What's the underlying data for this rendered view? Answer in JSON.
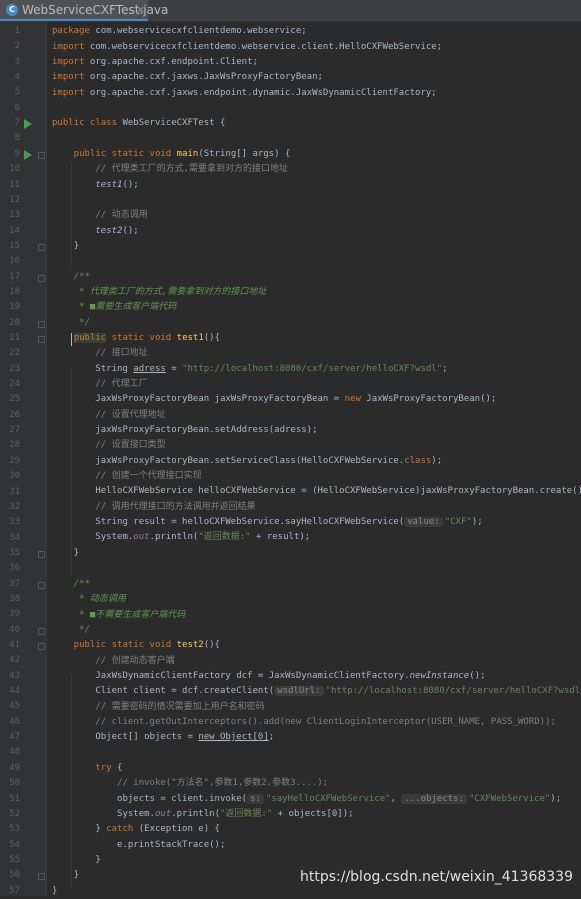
{
  "tab": {
    "filename": "WebServiceCXFTest.java",
    "close": "×"
  },
  "line_numbers": [
    "1",
    "2",
    "3",
    "4",
    "5",
    "6",
    "7",
    "8",
    "9",
    "10",
    "11",
    "12",
    "13",
    "14",
    "15",
    "16",
    "17",
    "18",
    "19",
    "20",
    "21",
    "22",
    "23",
    "24",
    "25",
    "26",
    "27",
    "28",
    "29",
    "30",
    "31",
    "32",
    "33",
    "34",
    "35",
    "36",
    "37",
    "38",
    "39",
    "40",
    "41",
    "42",
    "43",
    "44",
    "45",
    "46",
    "47",
    "48",
    "49",
    "50",
    "51",
    "52",
    "53",
    "54",
    "55",
    "56",
    "57"
  ],
  "code": {
    "l1": {
      "a": "package",
      "b": " com.webservicecxfclientdemo.webservice;"
    },
    "l2": {
      "a": "import",
      "b": " com.webservicecxfclientdemo.webservice.client.HelloCXFWebService;"
    },
    "l3": {
      "a": "import",
      "b": " org.apache.cxf.endpoint.Client;"
    },
    "l4": {
      "a": "import",
      "b": " org.apache.cxf.jaxws.JaxWsProxyFactoryBean;"
    },
    "l5": {
      "a": "import",
      "b": " org.apache.cxf.jaxws.endpoint.dynamic.JaxWsDynamicClientFactory;"
    },
    "l7": {
      "a": "public class",
      "b": " WebServiceCXFTest {"
    },
    "l9": {
      "a": "    public static void ",
      "b": "main",
      "c": "(String[] args) {"
    },
    "l10": {
      "a": "        // 代理类工厂的方式,需要拿到对方的接口地址"
    },
    "l11": {
      "a": "        ",
      "b": "test1",
      "c": "();"
    },
    "l13": {
      "a": "        // 动态调用"
    },
    "l14": {
      "a": "        ",
      "b": "test2",
      "c": "();"
    },
    "l15": {
      "a": "    }"
    },
    "l17": {
      "a": "    /**"
    },
    "l18": {
      "a": "     * 代理类工厂的方式,需要拿到对方的接口地址"
    },
    "l19": {
      "a": "     * ■需要生成客户端代码"
    },
    "l20": {
      "a": "     */"
    },
    "l21": {
      "a": "    ",
      "b": "public",
      "c": " static void ",
      "d": "test1",
      "e": "(){"
    },
    "l22": {
      "a": "        // 接口地址"
    },
    "l23": {
      "a": "        String ",
      "b": "adress",
      "c": " = ",
      "d": "\"http://localhost:8080/cxf/server/helloCXF?wsdl\"",
      "e": ";"
    },
    "l24": {
      "a": "        // 代理工厂"
    },
    "l25": {
      "a": "        JaxWsProxyFactoryBean jaxWsProxyFactoryBean = ",
      "b": "new",
      "c": " JaxWsProxyFactoryBean();"
    },
    "l26": {
      "a": "        // 设置代理地址"
    },
    "l27": {
      "a": "        jaxWsProxyFactoryBean.setAddress(adress);"
    },
    "l28": {
      "a": "        // 设置接口类型"
    },
    "l29": {
      "a": "        jaxWsProxyFactoryBean.setServiceClass(HelloCXFWebService.",
      "b": "class",
      "c": ");"
    },
    "l30": {
      "a": "        // 创建一个代理接口实现"
    },
    "l31": {
      "a": "        HelloCXFWebService helloCXFWebService = (HelloCXFWebService)jaxWsProxyFactoryBean.create();"
    },
    "l32": {
      "a": "        // 调用代理接口的方法调用并返回结果"
    },
    "l33": {
      "a": "        String result = helloCXFWebService.sayHelloCXFWebService(",
      "h": "value:",
      "b": "\"CXF\"",
      "c": ");"
    },
    "l34": {
      "a": "        System.",
      "b": "out",
      "c": ".println(",
      "d": "\"返回数据:\"",
      "e": " + result);"
    },
    "l35": {
      "a": "    }"
    },
    "l37": {
      "a": "    /**"
    },
    "l38": {
      "a": "     * 动态调用"
    },
    "l39": {
      "a": "     * ■不需要生成客户端代码"
    },
    "l40": {
      "a": "     */"
    },
    "l41": {
      "a": "    public static void ",
      "b": "test2",
      "c": "(){"
    },
    "l42": {
      "a": "        // 创建动态客户端"
    },
    "l43": {
      "a": "        JaxWsDynamicClientFactory dcf = JaxWsDynamicClientFactory.",
      "b": "newInstance",
      "c": "();"
    },
    "l44": {
      "a": "        Client client = dcf.createClient(",
      "h": "wsdlUrl:",
      "b": "\"http://localhost:8080/cxf/server/helloCXF?wsdl\"",
      "c": ");"
    },
    "l45": {
      "a": "        // 需要密码的情况需要加上用户名和密码"
    },
    "l46": {
      "a": "        // client.getOutInterceptors().add(new ClientLoginInterceptor(USER_NAME, PASS_WORD));"
    },
    "l47": {
      "a": "        Object[] objects = ",
      "b": "new Object[0]",
      "c": ";"
    },
    "l49": {
      "a": "        ",
      "b": "try",
      "c": " {"
    },
    "l50": {
      "a": "            // invoke(\"方法名\",参数1,参数2,参数3....);"
    },
    "l51": {
      "a": "            objects = client.invoke(",
      "h1": "s:",
      "b": "\"sayHelloCXFWebService\"",
      ", ": ", ",
      "h2": "...objects:",
      "c": "\"CXFWebService\"",
      "d": ");"
    },
    "l52": {
      "a": "            System.",
      "b": "out",
      "c": ".println(",
      "d": "\"返回数据:\"",
      "e": " + objects[0]);"
    },
    "l53": {
      "a": "        } ",
      "b": "catch",
      "c": " (Exception e) {"
    },
    "l54": {
      "a": "            e.printStackTrace();"
    },
    "l55": {
      "a": "        }"
    },
    "l56": {
      "a": "    }"
    },
    "l57": {
      "a": "}"
    }
  },
  "watermark": "https://blog.csdn.net/weixin_41368339"
}
